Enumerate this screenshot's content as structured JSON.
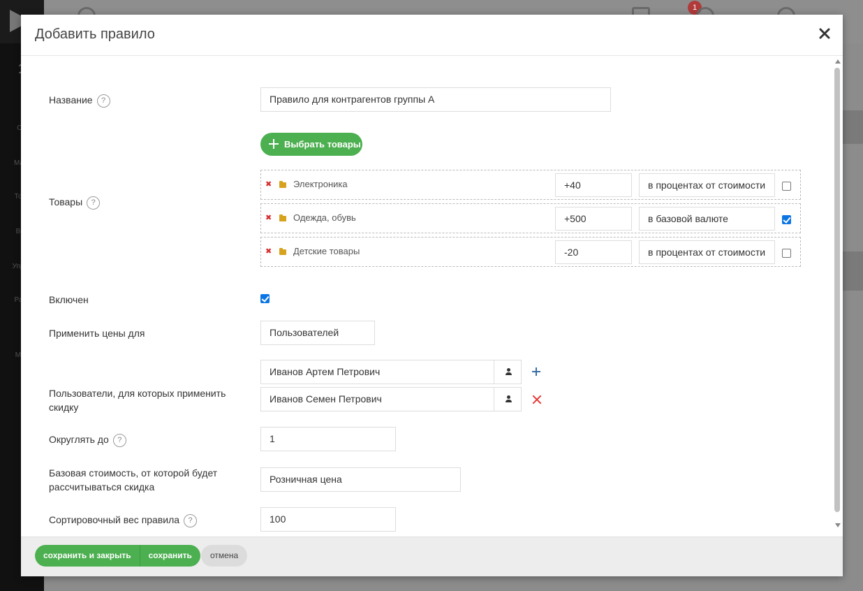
{
  "background": {
    "sidebar_labels": [
      "CR",
      "Мага",
      "Това",
      "Веб",
      "Управ",
      "Разд",
      "Мар"
    ],
    "top_logo_text": "1",
    "notification_count": "1"
  },
  "modal": {
    "title": "Добавить правило",
    "close_icon": "close-icon",
    "fields": {
      "name": {
        "label": "Название",
        "value": "Правило для контрагентов группы А"
      },
      "products": {
        "label": "Товары",
        "select_button": "Выбрать товары",
        "items": [
          {
            "name": "Электроника",
            "value": "+40",
            "mode": "в процентах от стоимости",
            "checked": false
          },
          {
            "name": "Одежда, обувь",
            "value": "+500",
            "mode": "в базовой валюте",
            "checked": true
          },
          {
            "name": "Детские товары",
            "value": "-20",
            "mode": "в процентах от стоимости",
            "checked": false
          }
        ]
      },
      "enabled": {
        "label": "Включен",
        "checked": true
      },
      "apply_for": {
        "label": "Применить цены для",
        "value": "Пользователей"
      },
      "users": {
        "label": "Пользователи, для которых применить скидку",
        "items": [
          "Иванов Артем Петрович",
          "Иванов Семен Петрович"
        ]
      },
      "round_to": {
        "label": "Округлять до",
        "value": "1"
      },
      "base_price": {
        "label": "Базовая стоимость, от которой будет рассчитываться скидка",
        "value": "Розничная цена"
      },
      "sort_weight": {
        "label": "Сортировочный вес правила",
        "value": "100"
      }
    },
    "footer": {
      "save_close": "сохранить и закрыть",
      "save": "сохранить",
      "cancel": "отмена"
    }
  },
  "colors": {
    "accent_green": "#4caf50",
    "remove_red": "#e53935",
    "folder": "#d7a21d",
    "checkbox_blue": "#0b75e3"
  }
}
